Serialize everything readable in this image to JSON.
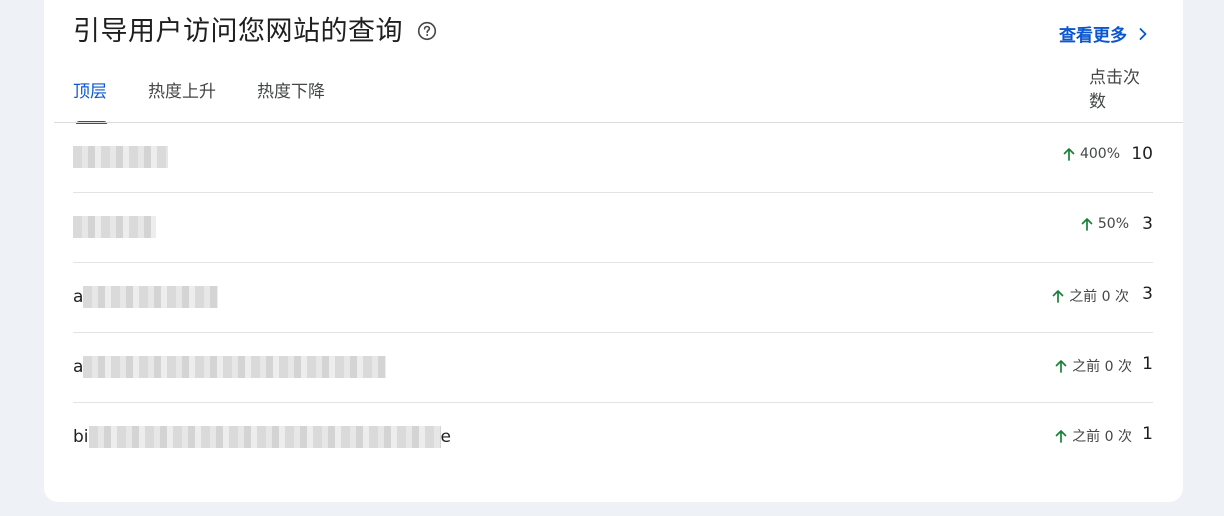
{
  "colors": {
    "accent": "#0b57d0",
    "up_arrow": "#188038",
    "text": "#1f1f1f",
    "muted_text": "#444746"
  },
  "card": {
    "title": "引导用户访问您网站的查询",
    "help_icon": "help-circle-icon",
    "view_more_label": "查看更多",
    "view_more_icon": "chevron-right-icon"
  },
  "tabs": [
    {
      "label": "顶层",
      "active": true
    },
    {
      "label": "热度上升",
      "active": false
    },
    {
      "label": "热度下降",
      "active": false
    }
  ],
  "table": {
    "column_header": "点击次数",
    "rows": [
      {
        "query_prefix": "",
        "change": "400%",
        "clicks": "10"
      },
      {
        "query_prefix": "",
        "change": "50%",
        "clicks": "3"
      },
      {
        "query_prefix": "a",
        "change": "之前 0 次",
        "clicks": "3"
      },
      {
        "query_prefix": "a",
        "change": "之前 0 次",
        "clicks": "1"
      },
      {
        "query_prefix": "bi",
        "query_suffix": "e",
        "change": "之前 0 次",
        "clicks": "1"
      }
    ]
  }
}
